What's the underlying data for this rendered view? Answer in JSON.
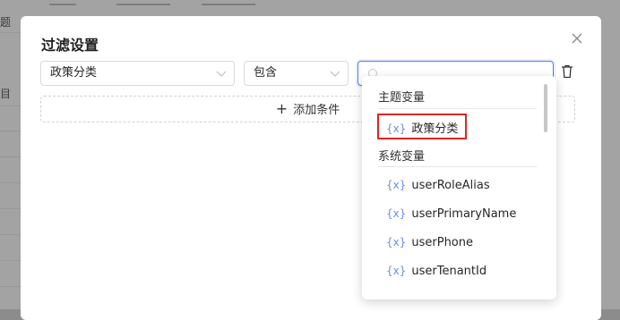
{
  "background": {
    "left_texts": [
      "题",
      "目"
    ]
  },
  "modal": {
    "title": "过滤设置",
    "field_select": {
      "value": "政策分类"
    },
    "operator_select": {
      "value": "包含"
    },
    "value_select": {
      "value": ""
    },
    "add_condition_label": "添加条件"
  },
  "dropdown": {
    "groups": [
      {
        "title": "主题变量",
        "options": [
          "政策分类"
        ]
      },
      {
        "title": "系统变量",
        "options": [
          "userRoleAlias",
          "userPrimaryName",
          "userPhone",
          "userTenantId"
        ]
      }
    ],
    "var_marker": "{x}",
    "highlighted_option": "政策分类"
  },
  "colors": {
    "accent": "#4d7cf6",
    "highlight_border": "#e02424"
  }
}
